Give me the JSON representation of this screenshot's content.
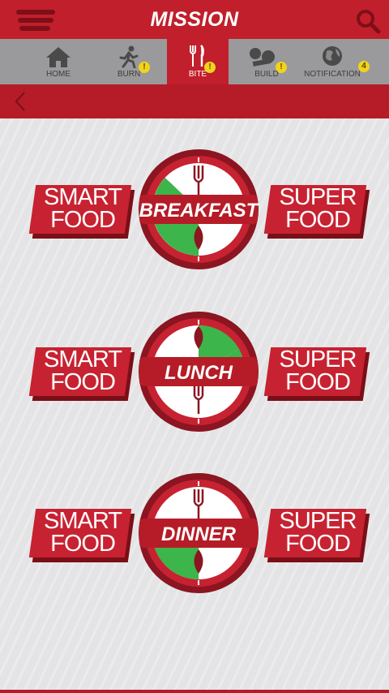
{
  "header": {
    "title": "MISSION"
  },
  "tabs": [
    {
      "label": "HOME",
      "icon": "home-icon",
      "badge": ""
    },
    {
      "label": "BURN",
      "icon": "runner-icon",
      "badge": "!"
    },
    {
      "label": "BITE",
      "icon": "fork-knife-icon",
      "badge": "!"
    },
    {
      "label": "BUILD",
      "icon": "dumbbell-icon",
      "badge": "!"
    },
    {
      "label": "NOTIFICATION",
      "icon": "globe-icon",
      "badge": "4"
    }
  ],
  "meals": [
    {
      "left_line1": "SMART",
      "left_line2": "FOOD",
      "name": "BREAKFAST",
      "right_line1": "SUPER",
      "right_line2": "FOOD"
    },
    {
      "left_line1": "SMART",
      "left_line2": "FOOD",
      "name": "LUNCH",
      "right_line1": "SUPER",
      "right_line2": "FOOD"
    },
    {
      "left_line1": "SMART",
      "left_line2": "FOOD",
      "name": "DINNER",
      "right_line1": "SUPER",
      "right_line2": "FOOD"
    }
  ],
  "colors": {
    "primary_red": "#c11f2b",
    "dark_red": "#8b1520",
    "progress_green": "#3cb54a",
    "badge_yellow": "#f2d31c",
    "tab_gray": "#9a9a9c"
  }
}
